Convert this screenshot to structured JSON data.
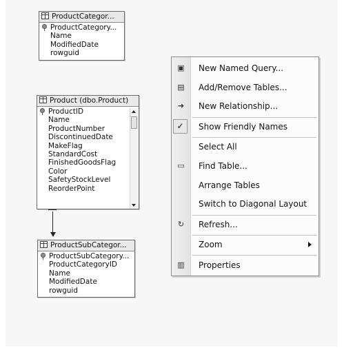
{
  "tables": {
    "category": {
      "title": "ProductCategor...",
      "columns": [
        "ProductCategory...",
        "Name",
        "ModifiedDate",
        "rowguid"
      ]
    },
    "product": {
      "title": "Product (dbo.Product)",
      "columns": [
        "ProductID",
        "Name",
        "ProductNumber",
        "DiscontinuedDate",
        "MakeFlag",
        "StandardCost",
        "FinishedGoodsFlag",
        "Color",
        "SafetyStockLevel",
        "ReorderPoint"
      ]
    },
    "subcategory": {
      "title": "ProductSubCategor...",
      "columns": [
        "ProductSubCategory...",
        "ProductCategoryID",
        "Name",
        "ModifiedDate",
        "rowguid"
      ]
    }
  },
  "menu": {
    "items": [
      {
        "label": "New Named Query...",
        "icon": "named-query-icon",
        "glyph": "▣"
      },
      {
        "label": "Add/Remove Tables...",
        "icon": "add-remove-tables-icon",
        "glyph": "▤"
      },
      {
        "label": "New Relationship...",
        "icon": "new-relationship-icon",
        "glyph": "➜"
      },
      {
        "label": "Show Friendly Names",
        "icon": "checkmark-icon",
        "glyph": "✓",
        "checked": true
      },
      {
        "label": "Select All"
      },
      {
        "label": "Find Table...",
        "icon": "find-table-icon",
        "glyph": "▭"
      },
      {
        "label": "Arrange Tables"
      },
      {
        "label": "Switch to Diagonal Layout"
      },
      {
        "label": "Refresh...",
        "icon": "refresh-icon",
        "glyph": "↻"
      },
      {
        "label": "Zoom",
        "submenu": true
      },
      {
        "label": "Properties",
        "icon": "properties-icon",
        "glyph": "▥"
      }
    ]
  }
}
